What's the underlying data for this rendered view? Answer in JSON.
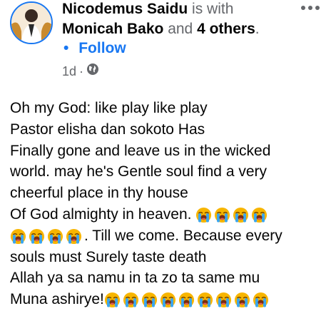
{
  "header": {
    "author": "Nicodemus Saidu",
    "is_with": "is with",
    "tagged": "Monicah Bako",
    "and_word": "and",
    "others": "4 others",
    "period": ".",
    "follow_dot": "•",
    "follow_label": "Follow",
    "time": "1d",
    "time_sep": "·",
    "menu_icon": "more-options-icon"
  },
  "post": {
    "l1": "Oh my God: like play like play",
    "l2": "Pastor elisha dan sokoto Has",
    "l3": "Finally gone and leave us in the wicked",
    "l4": "world. may he's Gentle soul find a very",
    "l5": "cheerful place in thy house",
    "l6": "Of God almighty  in heaven.",
    "l7": ". Till we come. Because every",
    "l8": "souls must Surely taste death",
    "l9": "Allah ya sa namu in ta zo ta same mu",
    "l10": "Muna ashirye!"
  },
  "emoji": {
    "name": "loudly-crying-face-icon",
    "face_color": "#f7b500",
    "tear_color": "#3aa6f0"
  }
}
